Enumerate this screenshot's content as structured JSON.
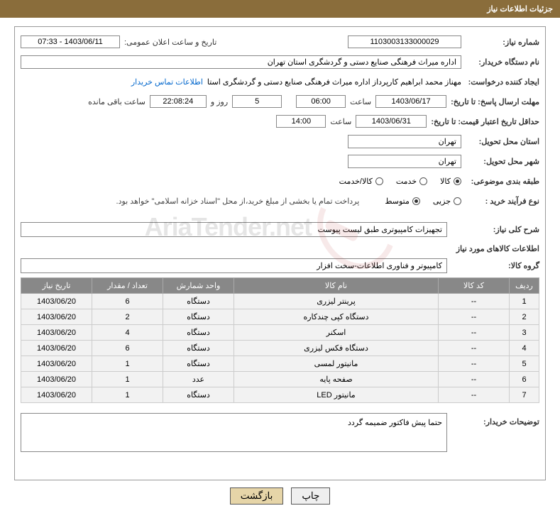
{
  "header": {
    "title": "جزئیات اطلاعات نیاز"
  },
  "need_no": {
    "label": "شماره نیاز:",
    "value": "1103003133000029"
  },
  "announce": {
    "label": "تاریخ و ساعت اعلان عمومی:",
    "value": "1403/06/11 - 07:33"
  },
  "org": {
    "label": "نام دستگاه خریدار:",
    "value": "اداره میراث فرهنگی  صنایع دستی و گردشگری استان تهران"
  },
  "requester": {
    "label": "ایجاد کننده درخواست:",
    "value": "مهناز محمد ابراهیم کارپرداز اداره میراث فرهنگی  صنایع دستی و گردشگری استا",
    "contact": "اطلاعات تماس خریدار"
  },
  "deadline_reply": {
    "label": "مهلت ارسال پاسخ: تا تاریخ:",
    "date": "1403/06/17",
    "time_lbl": "ساعت",
    "time": "06:00",
    "days": "5",
    "days_lbl": "روز و",
    "hms": "22:08:24",
    "remain_lbl": "ساعت باقی مانده"
  },
  "deadline_price": {
    "label": "حداقل تاریخ اعتبار قیمت: تا تاریخ:",
    "date": "1403/06/31",
    "time_lbl": "ساعت",
    "time": "14:00"
  },
  "deliver_prov": {
    "label": "استان محل تحویل:",
    "value": "تهران"
  },
  "deliver_city": {
    "label": "شهر محل تحویل:",
    "value": "تهران"
  },
  "topic_cls": {
    "label": "طبقه بندی موضوعی:",
    "opts": [
      "کالا",
      "خدمت",
      "کالا/خدمت"
    ],
    "checked": 0
  },
  "purchase_type": {
    "label": "نوع فرآیند خرید :",
    "opts": [
      "جزیی",
      "متوسط"
    ],
    "checked": 1,
    "note": "پرداخت تمام یا بخشی از مبلغ خرید،از محل \"اسناد خزانه اسلامی\" خواهد بود."
  },
  "need_desc": {
    "label": "شرح کلی نیاز:",
    "value": "تجهیزات کامپیوتری طبق لیست پیوست"
  },
  "goods_info": {
    "title": "اطلاعات کالاهای مورد نیاز"
  },
  "goods_group": {
    "label": "گروه کالا:",
    "value": "کامپیوتر و فناوری اطلاعات-سخت افزار"
  },
  "table": {
    "head": [
      "ردیف",
      "کد کالا",
      "نام کالا",
      "واحد شمارش",
      "تعداد / مقدار",
      "تاریخ نیاز"
    ],
    "rows": [
      {
        "idx": "1",
        "code": "--",
        "name": "پرینتر لیزری",
        "unit": "دستگاه",
        "qty": "6",
        "date": "1403/06/20"
      },
      {
        "idx": "2",
        "code": "--",
        "name": "دستگاه کپی چندکاره",
        "unit": "دستگاه",
        "qty": "2",
        "date": "1403/06/20"
      },
      {
        "idx": "3",
        "code": "--",
        "name": "اسکنر",
        "unit": "دستگاه",
        "qty": "4",
        "date": "1403/06/20"
      },
      {
        "idx": "4",
        "code": "--",
        "name": "دستگاه فکس لیزری",
        "unit": "دستگاه",
        "qty": "6",
        "date": "1403/06/20"
      },
      {
        "idx": "5",
        "code": "--",
        "name": "مانیتور لمسی",
        "unit": "دستگاه",
        "qty": "1",
        "date": "1403/06/20"
      },
      {
        "idx": "6",
        "code": "--",
        "name": "صفحه پایه",
        "unit": "عدد",
        "qty": "1",
        "date": "1403/06/20"
      },
      {
        "idx": "7",
        "code": "--",
        "name": "مانیتور LED",
        "unit": "دستگاه",
        "qty": "1",
        "date": "1403/06/20"
      }
    ]
  },
  "buyer_notes": {
    "label": "توضیحات خریدار:",
    "value": "حتما پیش فاکتور ضمیمه گردد"
  },
  "buttons": {
    "print": "چاپ",
    "back": "بازگشت"
  },
  "watermark": {
    "text": "AriaTender.net"
  }
}
